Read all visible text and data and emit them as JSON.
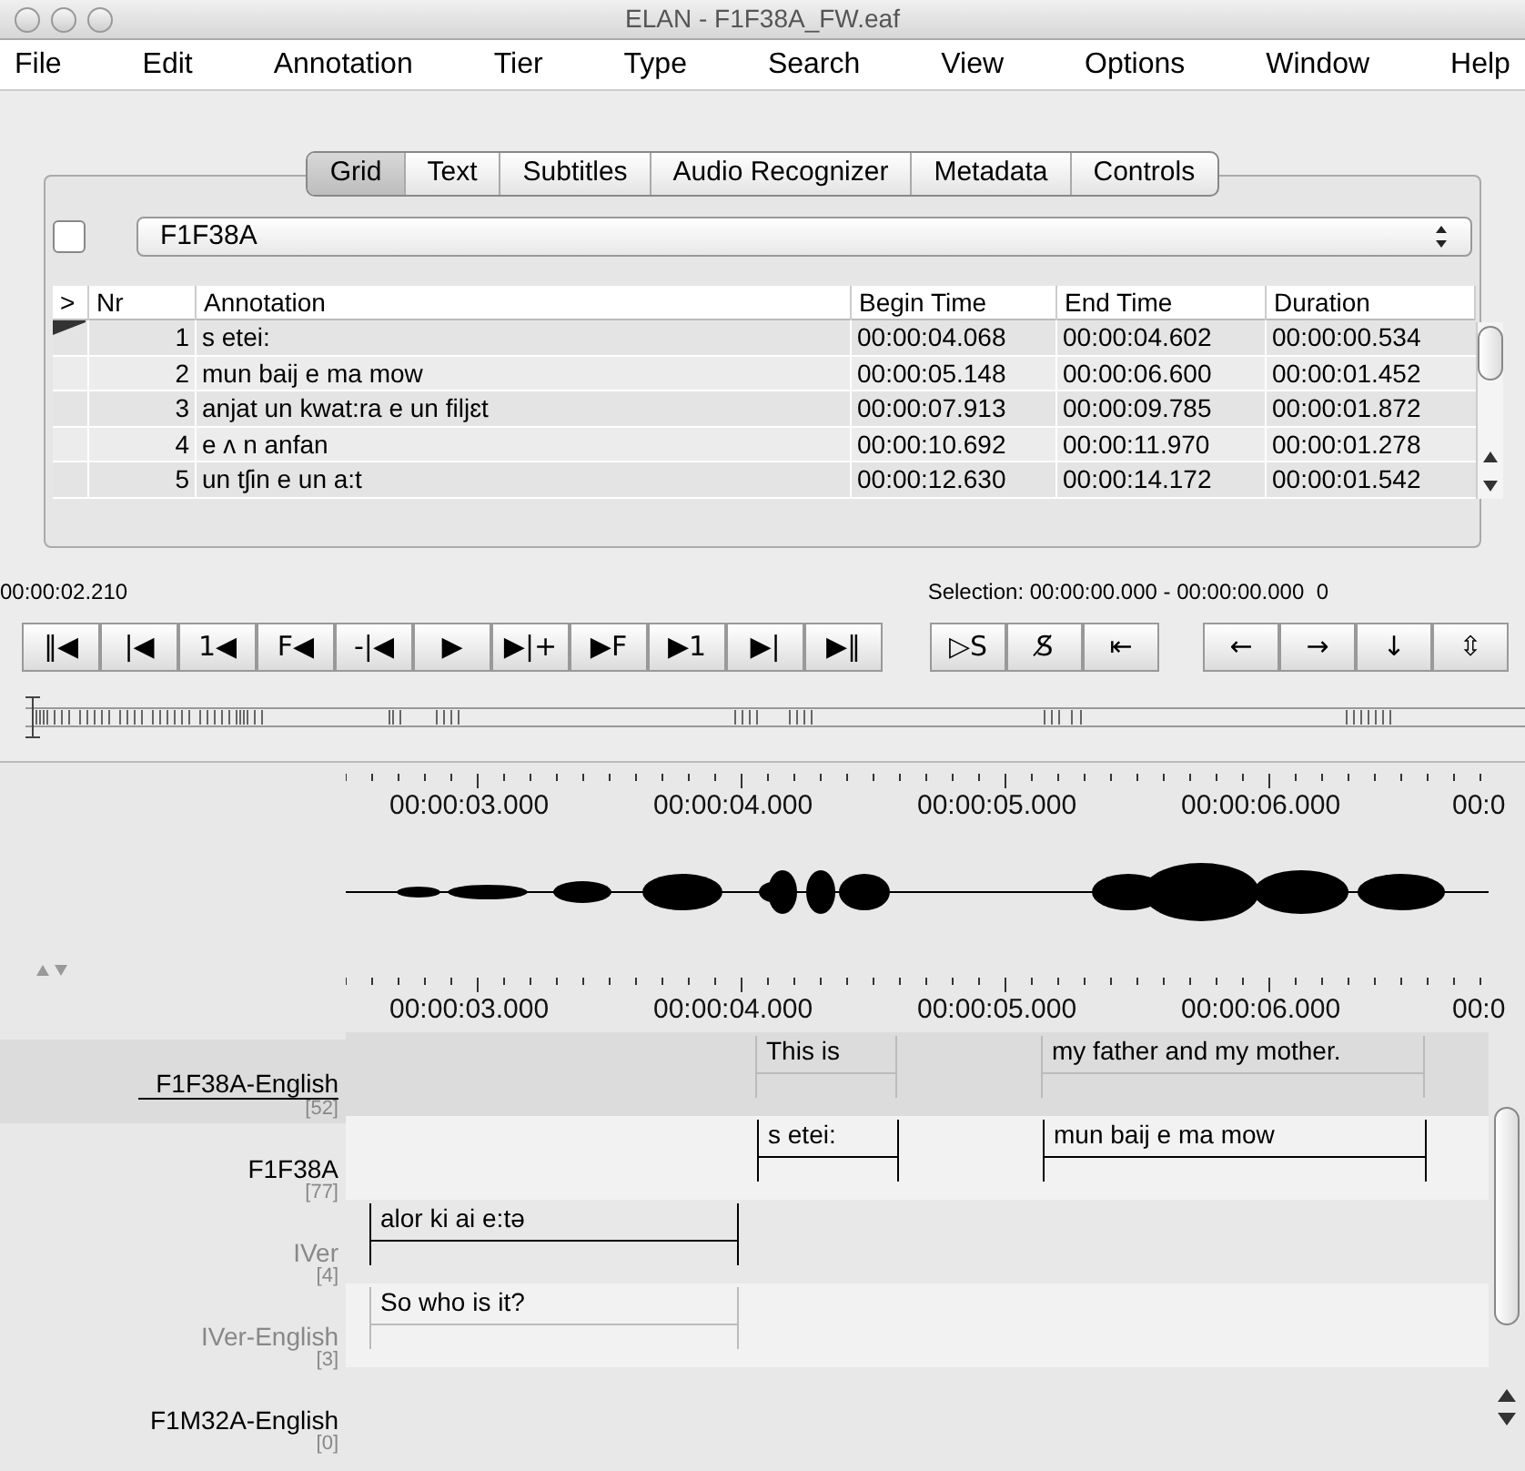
{
  "window": {
    "title": "ELAN - F1F38A_FW.eaf"
  },
  "menu": [
    "File",
    "Edit",
    "Annotation",
    "Tier",
    "Type",
    "Search",
    "View",
    "Options",
    "Window",
    "Help"
  ],
  "tabs": [
    {
      "label": "Grid",
      "selected": true
    },
    {
      "label": "Text",
      "selected": false
    },
    {
      "label": "Subtitles",
      "selected": false
    },
    {
      "label": "Audio Recognizer",
      "selected": false
    },
    {
      "label": "Metadata",
      "selected": false
    },
    {
      "label": "Controls",
      "selected": false
    }
  ],
  "grid": {
    "checked": false,
    "tier": "F1F38A",
    "columns": [
      ">",
      "Nr",
      "Annotation",
      "Begin Time",
      "End Time",
      "Duration"
    ],
    "rows": [
      {
        "selected": true,
        "nr": "1",
        "annotation": "s etei:",
        "begin": "00:00:04.068",
        "end": "00:00:04.602",
        "duration": "00:00:00.534"
      },
      {
        "selected": false,
        "nr": "2",
        "annotation": "mun baij e ma mow",
        "begin": "00:00:05.148",
        "end": "00:00:06.600",
        "duration": "00:00:01.452"
      },
      {
        "selected": false,
        "nr": "3",
        "annotation": "anjat un kwat:ra e un filjɛt",
        "begin": "00:00:07.913",
        "end": "00:00:09.785",
        "duration": "00:00:01.872"
      },
      {
        "selected": false,
        "nr": "4",
        "annotation": "e ʌ n anfan",
        "begin": "00:00:10.692",
        "end": "00:00:11.970",
        "duration": "00:00:01.278"
      },
      {
        "selected": false,
        "nr": "5",
        "annotation": "un tʃin e un a:t",
        "begin": "00:00:12.630",
        "end": "00:00:14.172",
        "duration": "00:00:01.542"
      }
    ]
  },
  "media_time": "00:00:02.210",
  "selection": "Selection: 00:00:00.000 - 00:00:00.000  0",
  "player_buttons": [
    "‖◀",
    "|◀",
    "1◀",
    "F◀",
    "-|◀",
    "▶",
    "▶|+",
    "▶F",
    "▶1",
    "▶|",
    "▶‖"
  ],
  "selection_buttons": [
    "▷S",
    "S̸",
    "⇤"
  ],
  "navigation_buttons": [
    "←",
    "→",
    "↓",
    "⇳"
  ],
  "ruler_top": [
    "00:00:03.000",
    "00:00:04.000",
    "00:00:05.000",
    "00:00:06.000",
    "00:0"
  ],
  "ruler_bottom": [
    "00:00:03.000",
    "00:00:04.000",
    "00:00:05.000",
    "00:00:06.000",
    "00:0"
  ],
  "tiers": [
    {
      "name": "F1F38A-English",
      "count": "[52]",
      "selected": true,
      "kind": "dependent",
      "dimmed": false,
      "annotations": [
        "This is",
        "my father and my mother."
      ]
    },
    {
      "name": "F1F38A",
      "count": "[77]",
      "selected": false,
      "kind": "independent",
      "dimmed": false,
      "annotations": [
        "s etei:",
        "mun baij e ma mow"
      ]
    },
    {
      "name": "IVer",
      "count": "[4]",
      "selected": false,
      "kind": "independent",
      "dimmed": true,
      "annotations": [
        "alor ki ai e:tə"
      ]
    },
    {
      "name": "IVer-English",
      "count": "[3]",
      "selected": false,
      "kind": "dependent",
      "dimmed": true,
      "annotations": [
        "So who is it?"
      ]
    },
    {
      "name": "F1M32A-English",
      "count": "[0]",
      "selected": false,
      "dimmed": false
    }
  ]
}
